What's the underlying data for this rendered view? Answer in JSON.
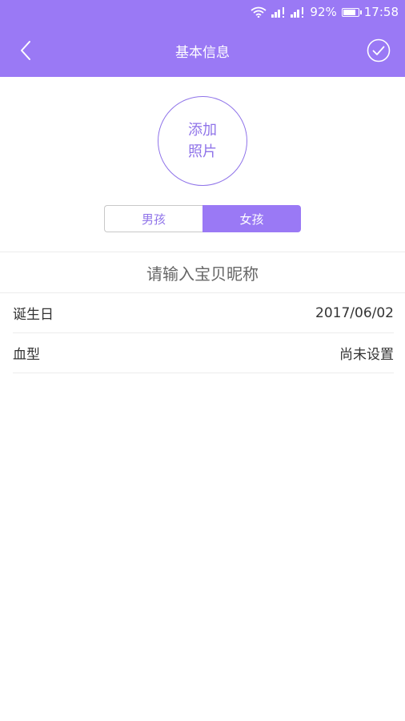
{
  "status_bar": {
    "battery_percent": "92%",
    "time": "17:58",
    "battery_level": 0.92
  },
  "header": {
    "title": "基本信息"
  },
  "avatar": {
    "line1": "添加",
    "line2": "照片"
  },
  "gender": {
    "male": "男孩",
    "female": "女孩",
    "selected": "女孩"
  },
  "nickname": {
    "placeholder": "请输入宝贝昵称"
  },
  "fields": [
    {
      "label": "诞生日",
      "value": "2017/06/02"
    },
    {
      "label": "血型",
      "value": "尚未设置"
    }
  ],
  "colors": {
    "accent": "#9a79f5",
    "accent_text": "#8f73e9"
  }
}
